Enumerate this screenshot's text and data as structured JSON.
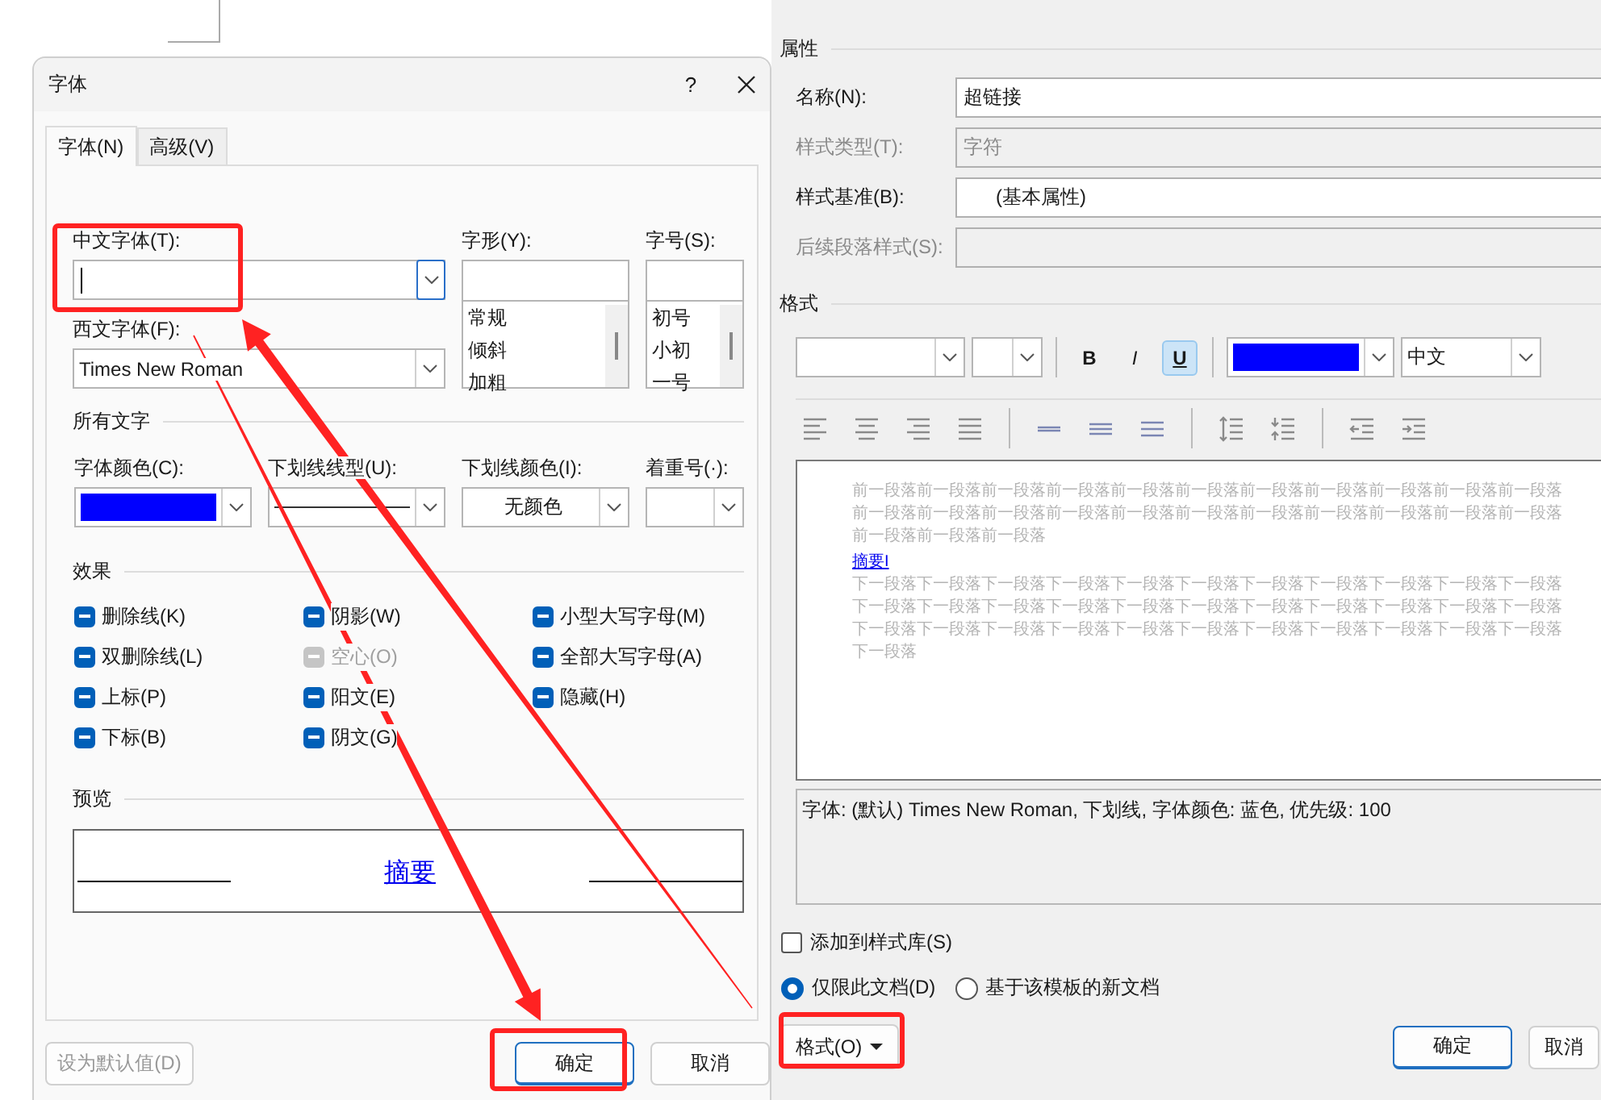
{
  "font_dialog": {
    "title": "字体",
    "help": "?",
    "tabs": [
      {
        "label": "字体(N)",
        "selected": true
      },
      {
        "label": "高级(V)",
        "selected": false
      }
    ],
    "chinese_font": {
      "label": "中文字体(T):"
    },
    "western_font": {
      "label": "西文字体(F):",
      "value": "Times New Roman"
    },
    "font_style": {
      "label": "字形(Y):",
      "options": [
        "常规",
        "倾斜",
        "加粗"
      ]
    },
    "font_size": {
      "label": "字号(S):",
      "options": [
        "初号",
        "小初",
        "一号"
      ]
    },
    "all_text": {
      "heading": "所有文字",
      "font_color": {
        "label": "字体颜色(C):",
        "color": "#0000ff"
      },
      "underline_style": {
        "label": "下划线线型(U):"
      },
      "underline_color": {
        "label": "下划线颜色(I):",
        "value": "无颜色"
      },
      "emphasis": {
        "label": "着重号(·):"
      }
    },
    "effects": {
      "heading": "效果",
      "items": [
        {
          "label": "删除线(K)",
          "mixed": true,
          "disabled": false
        },
        {
          "label": "阴影(W)",
          "mixed": true,
          "disabled": false
        },
        {
          "label": "小型大写字母(M)",
          "mixed": true,
          "disabled": false
        },
        {
          "label": "双删除线(L)",
          "mixed": true,
          "disabled": false
        },
        {
          "label": "空心(O)",
          "mixed": true,
          "disabled": true
        },
        {
          "label": "全部大写字母(A)",
          "mixed": true,
          "disabled": false
        },
        {
          "label": "上标(P)",
          "mixed": true,
          "disabled": false
        },
        {
          "label": "阳文(E)",
          "mixed": true,
          "disabled": false
        },
        {
          "label": "隐藏(H)",
          "mixed": true,
          "disabled": false
        },
        {
          "label": "下标(B)",
          "mixed": true,
          "disabled": false
        },
        {
          "label": "阴文(G)",
          "mixed": true,
          "disabled": false
        }
      ]
    },
    "preview": {
      "heading": "预览",
      "sample": "摘要"
    },
    "buttons": [
      {
        "label": "设为默认值(D)",
        "disabled": true,
        "default": false
      },
      {
        "label": "确定",
        "disabled": false,
        "default": true
      },
      {
        "label": "取消",
        "disabled": false,
        "default": false
      }
    ]
  },
  "style_dialog": {
    "properties": {
      "heading": "属性",
      "rows": [
        {
          "label": "名称(N):",
          "value": "超链接",
          "disabled": false
        },
        {
          "label": "样式类型(T):",
          "value": "字符",
          "disabled": true
        },
        {
          "label": "样式基准(B):",
          "value": "(基本属性)",
          "disabled": false
        },
        {
          "label": "后续段落样式(S):",
          "disabled": true
        }
      ]
    },
    "format": {
      "heading": "格式",
      "toggles": [
        {
          "label": "B",
          "kind": "bold",
          "on": false
        },
        {
          "label": "I",
          "kind": "italic",
          "on": false
        },
        {
          "label": "U",
          "kind": "underline",
          "on": true
        }
      ],
      "color": "#0000ff",
      "script": "中文"
    },
    "preview": {
      "before": "前一段落前一段落前一段落前一段落前一段落前一段落前一段落前一段落前一段落前一段落前一段落前一段落前一段落前一段落前一段落前一段落前一段落前一段落前一段落前一段落前一段落前一段落前一段落前一段落前一段落",
      "sample": "摘要I",
      "after": "下一段落下一段落下一段落下一段落下一段落下一段落下一段落下一段落下一段落下一段落下一段落下一段落下一段落下一段落下一段落下一段落下一段落下一段落下一段落下一段落下一段落下一段落下一段落下一段落下一段落下一段落下一段落下一段落下一段落下一段落下一段落下一段落下一段落下一段落"
    },
    "description": "字体: (默认) Times New Roman, 下划线, 字体颜色: 蓝色, 优先级: 100",
    "add_to_gallery": {
      "label": "添加到样式库(S)",
      "checked": false
    },
    "scope": [
      {
        "label": "仅限此文档(D)",
        "selected": true
      },
      {
        "label": "基于该模板的新文档",
        "selected": false
      }
    ],
    "format_button": {
      "label": "格式(O)"
    },
    "buttons": [
      {
        "label": "确定",
        "default": true
      },
      {
        "label": "取消",
        "default": false
      }
    ]
  }
}
